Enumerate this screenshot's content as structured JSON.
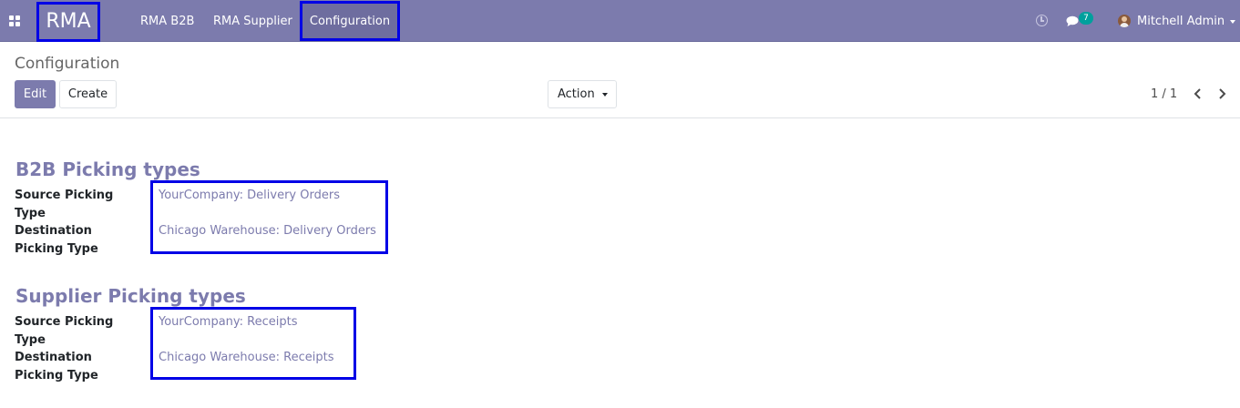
{
  "navbar": {
    "brand": "RMA",
    "menu": [
      {
        "label": "RMA B2B"
      },
      {
        "label": "RMA Supplier"
      },
      {
        "label": "Configuration"
      }
    ],
    "chat_badge_count": "7",
    "user_name": "Mitchell Admin",
    "icons": [
      "apps-grid-icon",
      "clock-icon",
      "chat-icon",
      "avatar",
      "caret-down-icon"
    ],
    "accent_color": "#7c7bad",
    "badge_color": "#00a09d",
    "highlight_color": "#0000e6"
  },
  "control_panel": {
    "breadcrumb": "Configuration",
    "edit_label": "Edit",
    "create_label": "Create",
    "action_label": "Action",
    "pager_value": "1 / 1"
  },
  "form": {
    "sections": [
      {
        "title": "B2B Picking types",
        "fields": [
          {
            "label": "Source Picking Type",
            "value": "YourCompany: Delivery Orders"
          },
          {
            "label": "Destination Picking Type",
            "value": "Chicago Warehouse: Delivery Orders"
          }
        ]
      },
      {
        "title": "Supplier Picking types",
        "fields": [
          {
            "label": "Source Picking Type",
            "value": "YourCompany: Receipts"
          },
          {
            "label": "Destination Picking Type",
            "value": "Chicago Warehouse: Receipts"
          }
        ]
      }
    ]
  }
}
